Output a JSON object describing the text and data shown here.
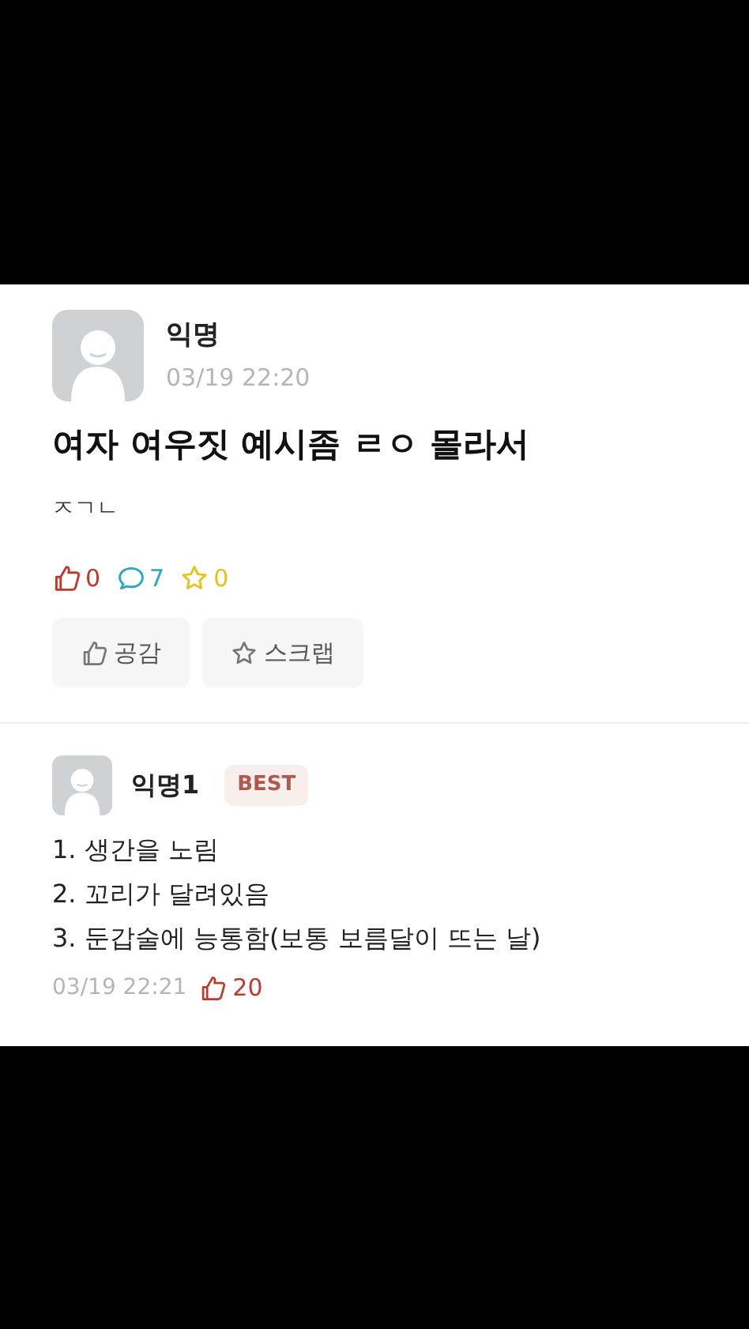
{
  "post": {
    "author": "익명",
    "time": "03/19 22:20",
    "title": "여자 여우짓 예시좀 ㄹㅇ 몰라서",
    "body": "ㅈㄱㄴ",
    "counts": [
      {
        "kind": "like",
        "value": "0"
      },
      {
        "kind": "comment",
        "value": "7"
      },
      {
        "kind": "scrap",
        "value": "0"
      }
    ],
    "buttons": [
      {
        "kind": "like",
        "label": "공감"
      },
      {
        "kind": "scrap",
        "label": "스크랩"
      }
    ]
  },
  "comment": {
    "author": "익명1",
    "badge": "BEST",
    "lines": [
      "1. 생간을 노림",
      "2. 꼬리가 달려있음",
      "3. 둔갑술에 능통함(보통 보름달이 뜨는 날)"
    ],
    "time": "03/19 22:21",
    "likes": "20"
  }
}
